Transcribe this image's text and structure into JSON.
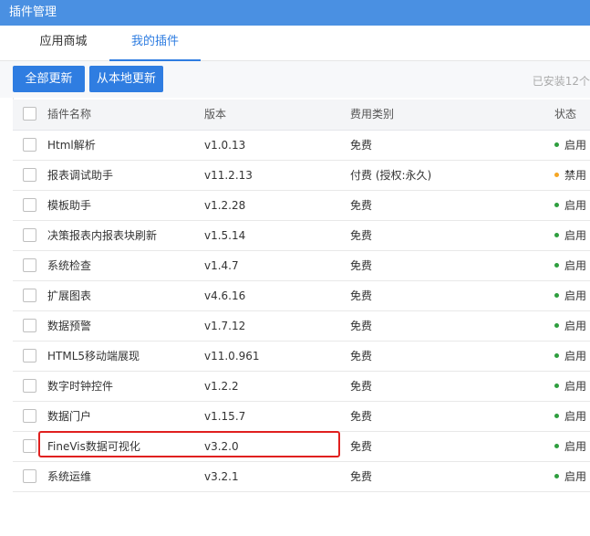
{
  "window": {
    "title": "插件管理"
  },
  "tabs": [
    {
      "label": "应用商城",
      "active": false
    },
    {
      "label": "我的插件",
      "active": true
    }
  ],
  "toolbar": {
    "update_all_label": "全部更新",
    "update_local_label": "从本地更新",
    "installed_text": "已安装12个"
  },
  "table": {
    "headers": {
      "name": "插件名称",
      "version": "版本",
      "fee": "费用类别",
      "status": "状态"
    },
    "rows": [
      {
        "name": "Html解析",
        "version": "v1.0.13",
        "fee": "免费",
        "status": "启用",
        "status_color": "#2e9e3e"
      },
      {
        "name": "报表调试助手",
        "version": "v11.2.13",
        "fee": "付费 (授权:永久)",
        "status": "禁用",
        "status_color": "#f5a623"
      },
      {
        "name": "模板助手",
        "version": "v1.2.28",
        "fee": "免费",
        "status": "启用",
        "status_color": "#2e9e3e"
      },
      {
        "name": "决策报表内报表块刷新",
        "version": "v1.5.14",
        "fee": "免费",
        "status": "启用",
        "status_color": "#2e9e3e"
      },
      {
        "name": "系统检查",
        "version": "v1.4.7",
        "fee": "免费",
        "status": "启用",
        "status_color": "#2e9e3e"
      },
      {
        "name": "扩展图表",
        "version": "v4.6.16",
        "fee": "免费",
        "status": "启用",
        "status_color": "#2e9e3e"
      },
      {
        "name": "数据预警",
        "version": "v1.7.12",
        "fee": "免费",
        "status": "启用",
        "status_color": "#2e9e3e"
      },
      {
        "name": "HTML5移动端展现",
        "version": "v11.0.961",
        "fee": "免费",
        "status": "启用",
        "status_color": "#2e9e3e"
      },
      {
        "name": "数字时钟控件",
        "version": "v1.2.2",
        "fee": "免费",
        "status": "启用",
        "status_color": "#2e9e3e"
      },
      {
        "name": "数据门户",
        "version": "v1.15.7",
        "fee": "免费",
        "status": "启用",
        "status_color": "#2e9e3e"
      },
      {
        "name": "FineVis数据可视化",
        "version": "v3.2.0",
        "fee": "免费",
        "status": "启用",
        "status_color": "#2e9e3e"
      },
      {
        "name": "系统运维",
        "version": "v3.2.1",
        "fee": "免费",
        "status": "启用",
        "status_color": "#2e9e3e"
      }
    ]
  },
  "colors": {
    "accent": "#2f7de1",
    "titlebar": "#4a90e2",
    "highlight": "#e0201f"
  }
}
